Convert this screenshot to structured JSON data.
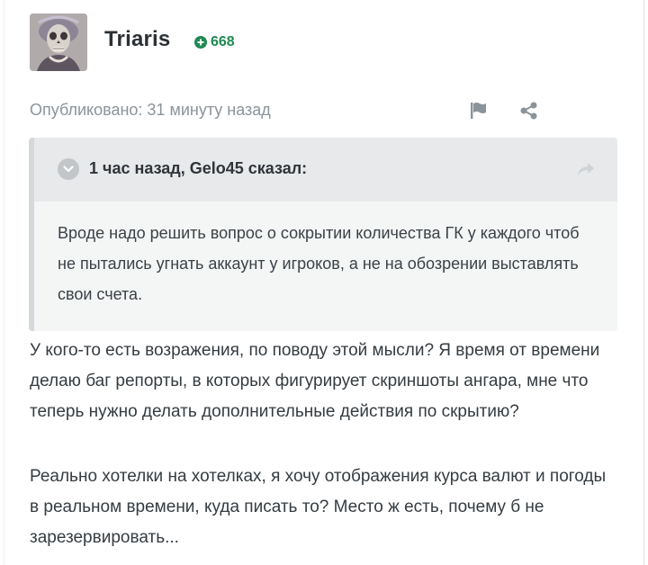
{
  "author": {
    "name": "Triaris",
    "reputation": "668",
    "avatar_icon": "skull-portrait-avatar"
  },
  "post_meta": {
    "published": "Опубликовано: 31 минуту назад"
  },
  "actions": {
    "report_icon": "flag-icon",
    "share_icon": "share-icon"
  },
  "quote": {
    "citation": "1 час назад, Gelo45 сказал:",
    "text": "Вроде надо решить вопрос о сокрытии количества ГК у каждого чтоб не пытались угнать аккаунт у игроков, а не на обозрении выставлять свои счета."
  },
  "body": {
    "paragraph_1": "У кого-то есть возражения, по поводу этой мысли? Я время от времени делаю баг репорты, в которых фигурирует скриншоты ангара, мне что теперь нужно делать дополнительные действия по скрытию?",
    "paragraph_2": "Реально хотелки на хотелках, я хочу отображения курса валют и погоды в реальном времени, куда писать то? Место ж есть, почему б не зарезервировать..."
  },
  "colors": {
    "reputation": "#1f8a52",
    "muted_text": "#8b949b",
    "quote_header_bg": "#e8e9ea",
    "quote_body_bg": "#f4f5f5"
  }
}
